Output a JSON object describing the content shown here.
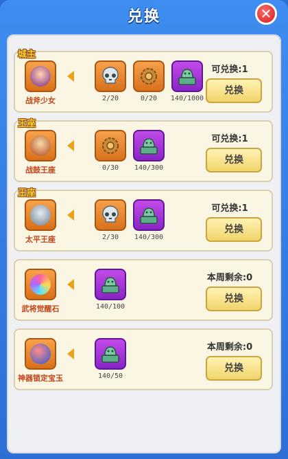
{
  "header": {
    "title": "兑换",
    "close_symbol": "✕"
  },
  "rows": [
    {
      "target": {
        "tag": "城主",
        "name": "战斧少女",
        "icon": "hero-portrait-icon"
      },
      "materials": [
        {
          "icon": "skull-icon",
          "color": "orange",
          "count": "2/20"
        },
        {
          "icon": "gear-icon",
          "color": "orange",
          "count": "0/20"
        },
        {
          "icon": "jade-seal-icon",
          "color": "purple",
          "count": "140/1000"
        }
      ],
      "status": "可兑换:1",
      "button": "兑换"
    },
    {
      "target": {
        "tag": "王座",
        "name": "战鼓王座",
        "icon": "drum-throne-icon"
      },
      "materials": [
        {
          "icon": "gear-icon",
          "color": "orange",
          "count": "0/30"
        },
        {
          "icon": "jade-seal-icon",
          "color": "purple",
          "count": "140/300"
        }
      ],
      "status": "可兑换:1",
      "button": "兑换"
    },
    {
      "target": {
        "tag": "王座",
        "name": "太平王座",
        "icon": "peace-throne-icon"
      },
      "materials": [
        {
          "icon": "skull-icon",
          "color": "orange",
          "count": "2/30"
        },
        {
          "icon": "jade-seal-icon",
          "color": "purple",
          "count": "140/300"
        }
      ],
      "status": "可兑换:1",
      "button": "兑换"
    },
    {
      "target": {
        "tag": "",
        "name": "武将觉醒石",
        "icon": "crystal-icon"
      },
      "materials": [
        {
          "icon": "jade-seal-icon",
          "color": "purple",
          "count": "140/100"
        }
      ],
      "status": "本周剩余:0",
      "button": "兑换"
    },
    {
      "target": {
        "tag": "",
        "name": "神器锁定宝玉",
        "icon": "jade-orb-icon"
      },
      "materials": [
        {
          "icon": "jade-seal-icon",
          "color": "purple",
          "count": "140/50"
        }
      ],
      "status": "本周剩余:0",
      "button": "兑换"
    }
  ]
}
